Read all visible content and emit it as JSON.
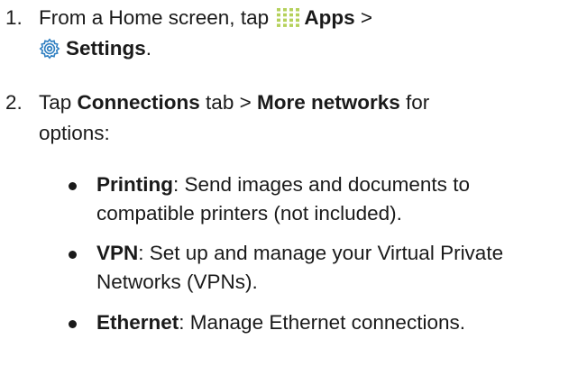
{
  "steps": [
    {
      "number": "1.",
      "pre": "From a Home screen, tap ",
      "apps_label": "Apps",
      "sep": " >",
      "settings_label": "Settings",
      "end": "."
    },
    {
      "number": "2.",
      "pre": "Tap ",
      "connections_label": "Connections",
      "mid": " tab > ",
      "more_label": "More networks",
      "post": " for",
      "line2": "options:"
    }
  ],
  "options": [
    {
      "term": "Printing",
      "line1": ": Send images and documents to",
      "line2": "compatible printers (not included)."
    },
    {
      "term": "VPN",
      "line1": ": Set up and manage your Virtual Private",
      "line2": "Networks (VPNs)."
    },
    {
      "term": "Ethernet",
      "line1": ": Manage Ethernet connections.",
      "line2": ""
    }
  ],
  "icons": {
    "apps": "apps-grid-icon",
    "settings": "settings-gear-icon",
    "apps_color": "#b5d15b",
    "settings_color": "#2f7fc1"
  }
}
